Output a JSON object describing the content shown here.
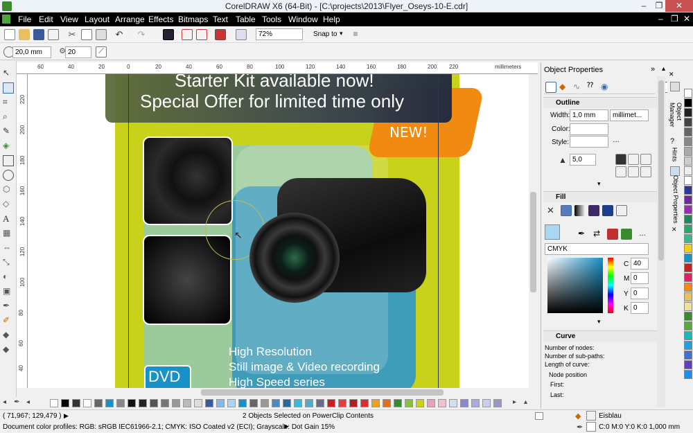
{
  "window": {
    "title": "CorelDRAW X6 (64-Bit) - [C:\\projects\\2013\\Flyer_Oseys-10-E.cdr]",
    "controls": [
      "–",
      "❐",
      "✕"
    ],
    "doc_controls": [
      "–",
      "❐",
      "✕"
    ]
  },
  "menu": [
    "File",
    "Edit",
    "View",
    "Layout",
    "Arrange",
    "Effects",
    "Bitmaps",
    "Text",
    "Table",
    "Tools",
    "Window",
    "Help"
  ],
  "toolbar1": {
    "zoom": "72%",
    "snap_to": "Snap to"
  },
  "toolbar2": {
    "nudge": "20,0 mm",
    "angle": "20"
  },
  "ruler": {
    "top_labels": [
      "60",
      "40",
      "20",
      "0",
      "20",
      "40",
      "60",
      "80",
      "100",
      "120",
      "140",
      "160",
      "180",
      "200",
      "220"
    ],
    "unit": "millimeters",
    "left_labels": [
      "220",
      "200",
      "180",
      "160",
      "140",
      "120",
      "100",
      "80",
      "60",
      "40"
    ],
    "left_unit": "millimeters"
  },
  "flyer": {
    "headline1": "Starter Kit available now!",
    "headline2": "Special Offer for limited time only",
    "badge": "NEW!",
    "feature1": "High Resolution",
    "feature2": "Still image & Video recording",
    "feature3": "High Speed series",
    "dvd": "DVD"
  },
  "status": {
    "cursor": "( 71,967; 129,479 )",
    "selection": "2 Objects Selected on PowerClip Contents",
    "profiles": "Document color profiles: RGB: sRGB IEC61966-2.1; CMYK: ISO Coated v2 (ECI); Grayscale: Dot Gain 15%",
    "fill_name": "Eisblau",
    "outline_info": "C:0 M:0 Y:0 K:0  1,000 mm"
  },
  "docker": {
    "title": "Object Properties",
    "outline": {
      "header": "Outline",
      "width_label": "Width:",
      "width_value": "1,0 mm",
      "unit_value": "millimet...",
      "color_label": "Color:",
      "style_label": "Style:",
      "miter_value": "5,0"
    },
    "fill": {
      "header": "Fill",
      "model": "CMYK",
      "c_label": "C",
      "c_value": "40",
      "m_label": "M",
      "m_value": "0",
      "y_label": "Y",
      "y_value": "0",
      "k_label": "K",
      "k_value": "0",
      "swatch_color": "#a9d6f0"
    },
    "curve": {
      "header": "Curve",
      "nodes_label": "Number of nodes:",
      "subpaths_label": "Number of sub-paths:",
      "length_label": "Length of curve:",
      "node_position": "Node position",
      "first": "First:",
      "last": "Last:"
    }
  },
  "dock_tabs": [
    "Object Manager",
    "Hints",
    "Object Properties"
  ],
  "colors": {
    "flyer_green": "#c8d21a",
    "orange": "#f08a10",
    "dvd_blue": "#1890c8"
  }
}
